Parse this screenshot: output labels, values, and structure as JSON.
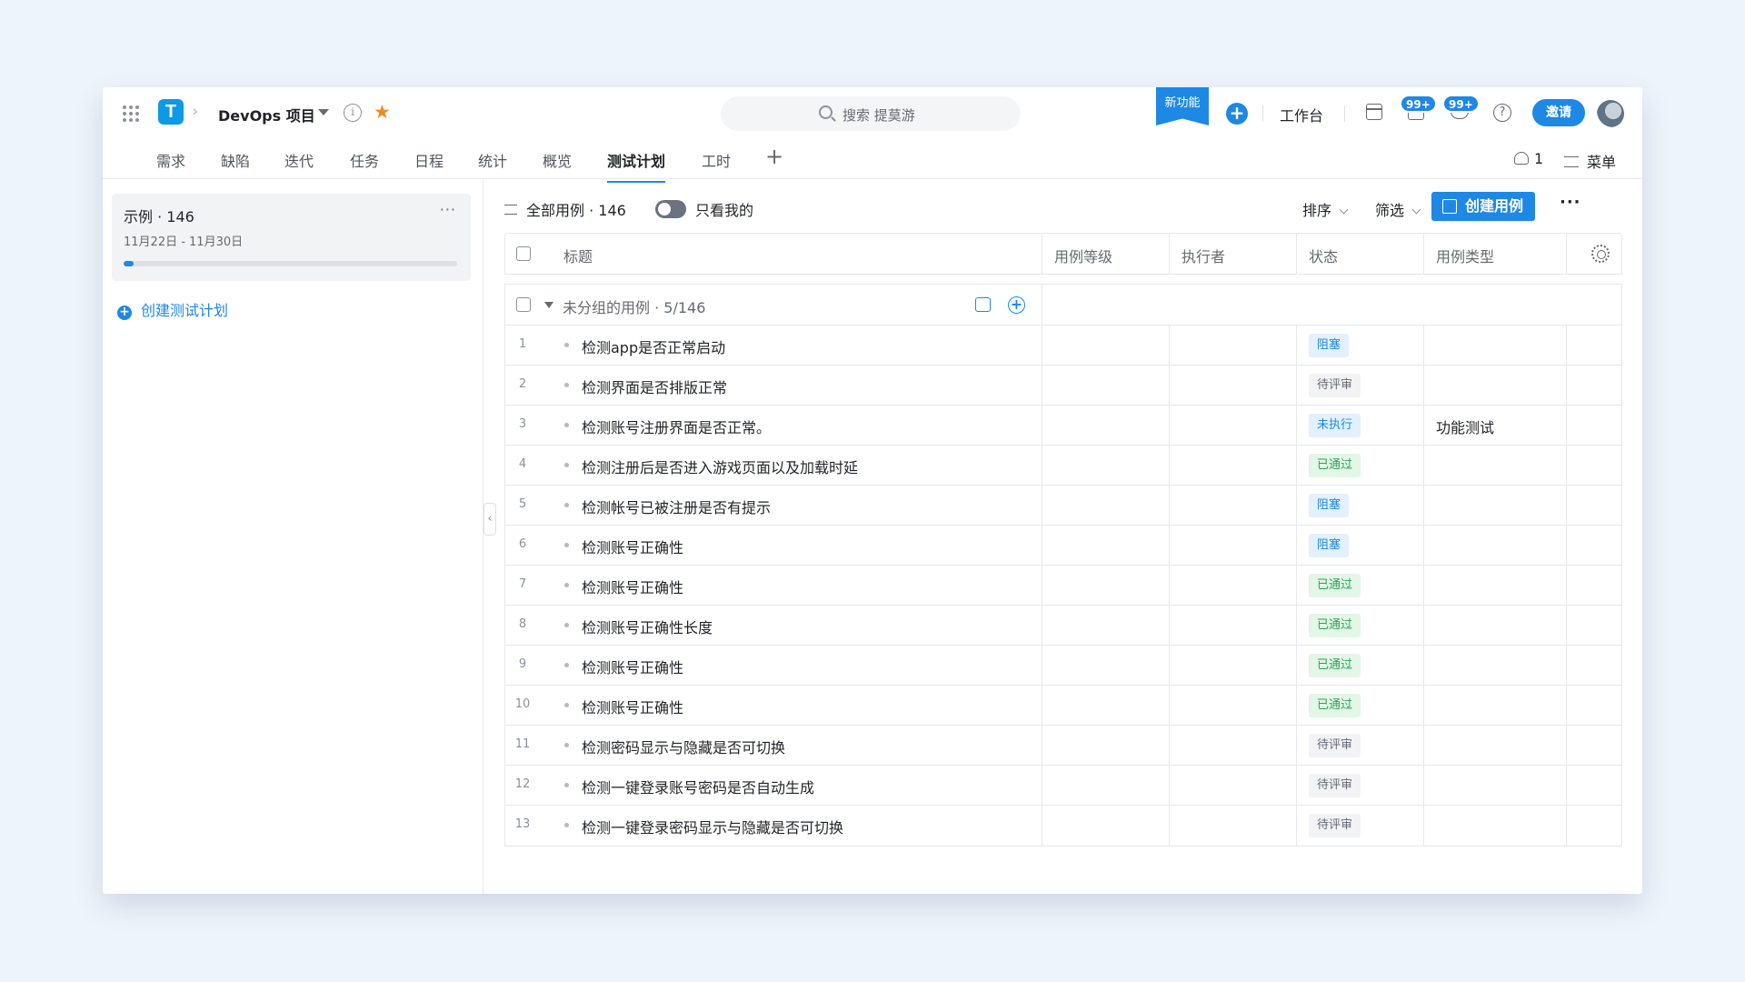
{
  "header": {
    "project_name": "DevOps 项目",
    "search_placeholder": "搜索 提莫游",
    "new_feature_label": "新功能",
    "workbench_label": "工作台",
    "notification_badge": "99+",
    "message_badge": "99+",
    "invite_label": "邀请",
    "logo_text": "T",
    "help_glyph": "?",
    "info_glyph": "i"
  },
  "tabs": [
    {
      "label": "需求"
    },
    {
      "label": "缺陷"
    },
    {
      "label": "迭代"
    },
    {
      "label": "任务"
    },
    {
      "label": "日程"
    },
    {
      "label": "统计"
    },
    {
      "label": "概览"
    },
    {
      "label": "测试计划",
      "active": true
    },
    {
      "label": "工时"
    }
  ],
  "tabbar_right": {
    "members_count": "1",
    "menu_label": "菜单"
  },
  "left_panel": {
    "plan": {
      "title": "示例 · 146",
      "date_range": "11月22日 - 11月30日",
      "progress_fraction": 0.03
    },
    "create_plan_label": "创建测试计划"
  },
  "toolbar": {
    "all_cases_label": "全部用例 · 146",
    "only_mine_label": "只看我的",
    "only_mine_on": false,
    "sort_label": "排序",
    "filter_label": "筛选",
    "create_case_label": "创建用例"
  },
  "table": {
    "columns": [
      "标题",
      "用例等级",
      "执行者",
      "状态",
      "用例类型"
    ],
    "group_label": "未分组的用例 · 5/146",
    "rows": [
      {
        "num": "1",
        "title": "检测app是否正常启动",
        "status": "阻塞",
        "status_kind": "blocked",
        "type": ""
      },
      {
        "num": "2",
        "title": "检测界面是否排版正常",
        "status": "待评审",
        "status_kind": "review",
        "type": ""
      },
      {
        "num": "3",
        "title": "检测账号注册界面是否正常。",
        "status": "未执行",
        "status_kind": "notrun",
        "type": "功能测试"
      },
      {
        "num": "4",
        "title": "检测注册后是否进入游戏页面以及加载时延",
        "status": "已通过",
        "status_kind": "passed",
        "type": ""
      },
      {
        "num": "5",
        "title": "检测帐号已被注册是否有提示",
        "status": "阻塞",
        "status_kind": "blocked",
        "type": ""
      },
      {
        "num": "6",
        "title": "检测账号正确性",
        "status": "阻塞",
        "status_kind": "blocked",
        "type": ""
      },
      {
        "num": "7",
        "title": "检测账号正确性",
        "status": "已通过",
        "status_kind": "passed",
        "type": ""
      },
      {
        "num": "8",
        "title": "检测账号正确性长度",
        "status": "已通过",
        "status_kind": "passed",
        "type": ""
      },
      {
        "num": "9",
        "title": "检测账号正确性",
        "status": "已通过",
        "status_kind": "passed",
        "type": ""
      },
      {
        "num": "10",
        "title": "检测账号正确性",
        "status": "已通过",
        "status_kind": "passed",
        "type": ""
      },
      {
        "num": "11",
        "title": "检测密码显示与隐藏是否可切换",
        "status": "待评审",
        "status_kind": "review",
        "type": ""
      },
      {
        "num": "12",
        "title": "检测一键登录账号密码是否自动生成",
        "status": "待评审",
        "status_kind": "review",
        "type": ""
      },
      {
        "num": "13",
        "title": "检测一键登录密码显示与隐藏是否可切换",
        "status": "待评审",
        "status_kind": "review",
        "type": ""
      }
    ]
  },
  "colors": {
    "accent": "#1e88e5",
    "star": "#f28a1c",
    "passed": "#2ea44f",
    "background": "#eef4fb"
  }
}
